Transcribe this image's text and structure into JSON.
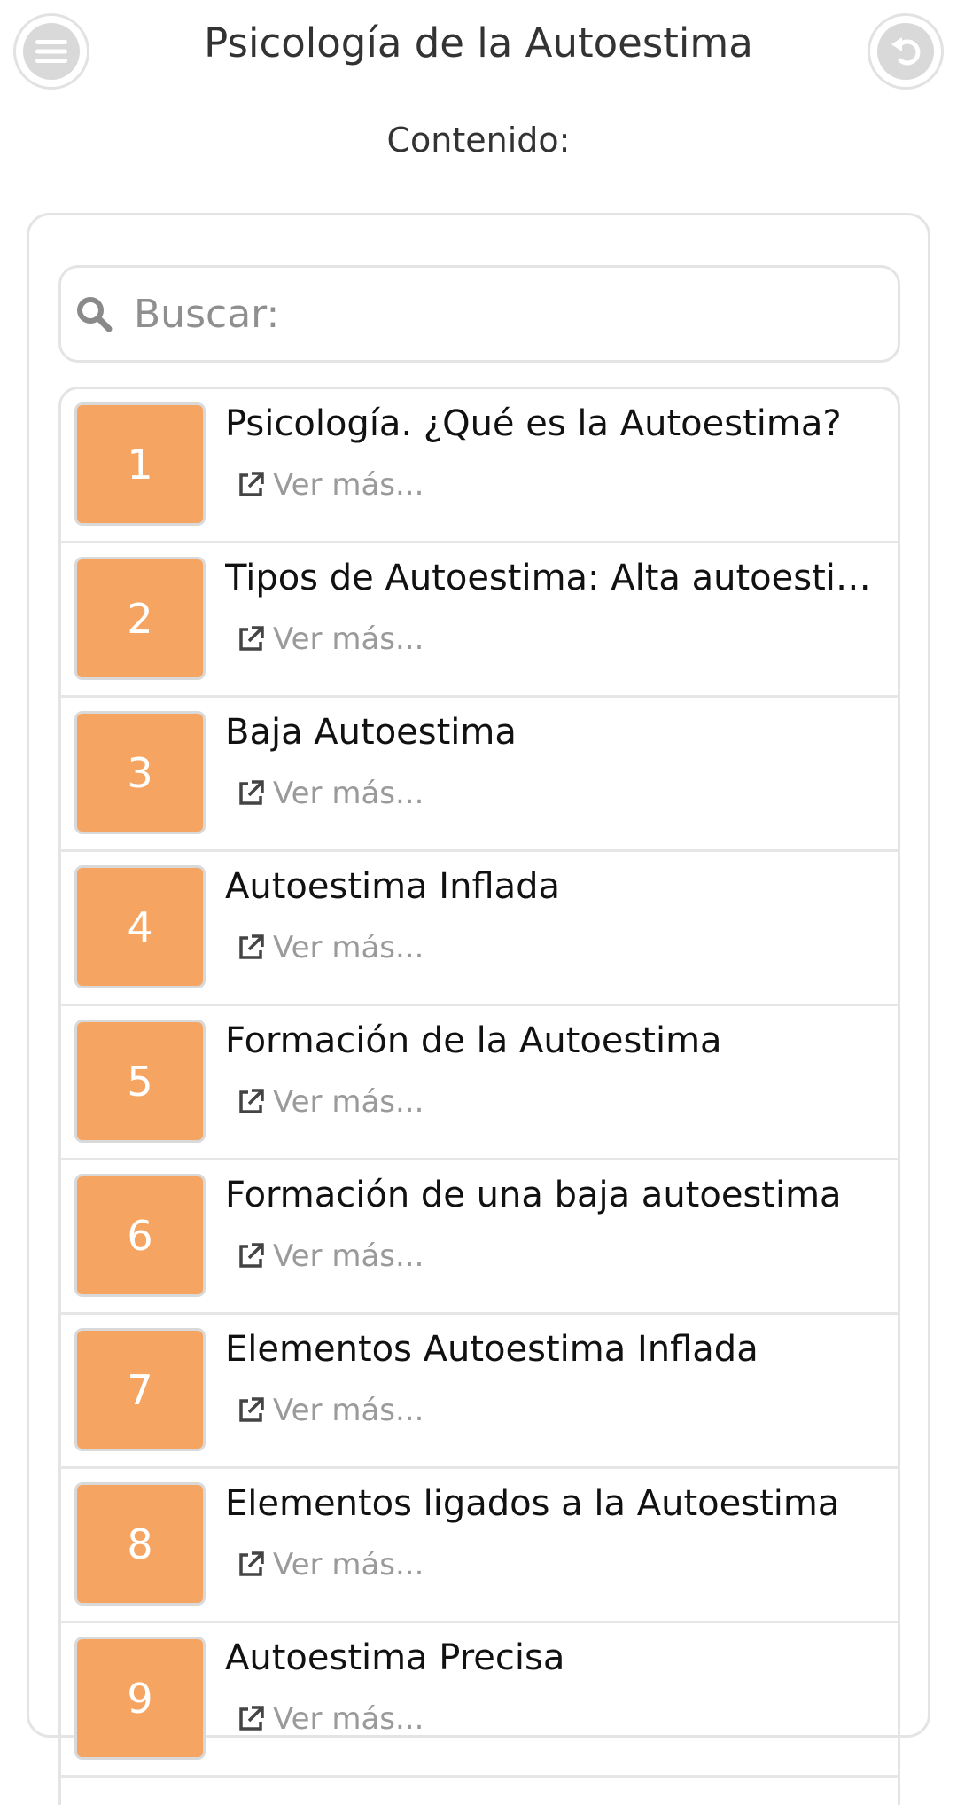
{
  "header": {
    "title": "Psicología de la Autoestima",
    "menu_icon": "hamburger-menu-icon",
    "back_icon": "undo-arrow-icon"
  },
  "subtitle": "Contenido:",
  "search": {
    "placeholder": "Buscar:",
    "value": "",
    "icon": "search-icon"
  },
  "colors": {
    "accent": "#f6a461",
    "border": "#e4e4e4",
    "muted_text": "#9a9a9a"
  },
  "items": [
    {
      "number": "1",
      "title": "Psicología. ¿Qué es la Autoestima?",
      "link_label": "Ver más..."
    },
    {
      "number": "2",
      "title": "Tipos de Autoestima: Alta autoestima",
      "link_label": "Ver más..."
    },
    {
      "number": "3",
      "title": "Baja Autoestima",
      "link_label": "Ver más..."
    },
    {
      "number": "4",
      "title": "Autoestima Inflada",
      "link_label": "Ver más..."
    },
    {
      "number": "5",
      "title": "Formación de la Autoestima",
      "link_label": "Ver más..."
    },
    {
      "number": "6",
      "title": "Formación de una baja autoestima",
      "link_label": "Ver más..."
    },
    {
      "number": "7",
      "title": "Elementos Autoestima Inflada",
      "link_label": "Ver más..."
    },
    {
      "number": "8",
      "title": "Elementos ligados a la Autoestima",
      "link_label": "Ver más..."
    },
    {
      "number": "9",
      "title": "Autoestima Precisa",
      "link_label": "Ver más..."
    }
  ]
}
